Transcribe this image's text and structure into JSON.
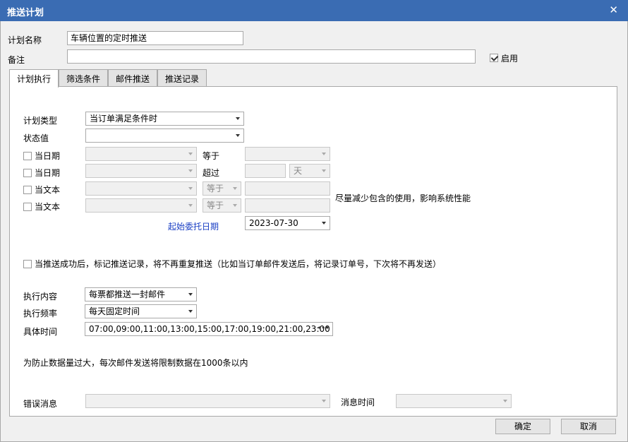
{
  "window": {
    "title": "推送计划"
  },
  "form": {
    "plan_name_label": "计划名称",
    "plan_name_value": "车辆位置的定时推送",
    "remark_label": "备注",
    "remark_value": "",
    "enable_label": "启用",
    "enable_checked": true
  },
  "tabs": [
    {
      "label": "计划执行"
    },
    {
      "label": "筛选条件"
    },
    {
      "label": "邮件推送"
    },
    {
      "label": "推送记录"
    }
  ],
  "exec": {
    "plan_type_label": "计划类型",
    "plan_type_value": "当订单满足条件时",
    "status_label": "状态值",
    "status_value": "",
    "row1": {
      "check_label": "当日期",
      "op": "等于"
    },
    "row2": {
      "check_label": "当日期",
      "op": "超过",
      "unit": "天"
    },
    "row3": {
      "check_label": "当文本",
      "op": "等于"
    },
    "row4": {
      "check_label": "当文本",
      "op": "等于"
    },
    "text_hint": "尽量减少包含的使用，影响系统性能",
    "start_date_label": "起始委托日期",
    "start_date_value": "2023-07-30",
    "mark_record_label": "当推送成功后，标记推送记录，将不再重复推送（比如当订单邮件发送后，将记录订单号，下次将不再发送）",
    "content_label": "执行内容",
    "content_value": "每票都推送一封邮件",
    "freq_label": "执行频率",
    "freq_value": "每天固定时间",
    "time_label": "具体时间",
    "time_value": "07:00,09:00,11:00,13:00,15:00,17:00,19:00,21:00,23:00",
    "limit_note": "为防止数据量过大，每次邮件发送将限制数据在1000条以内",
    "error_label": "错误消息",
    "error_value": "",
    "msg_time_label": "消息时间",
    "msg_time_value": ""
  },
  "buttons": {
    "ok": "确定",
    "cancel": "取消"
  }
}
